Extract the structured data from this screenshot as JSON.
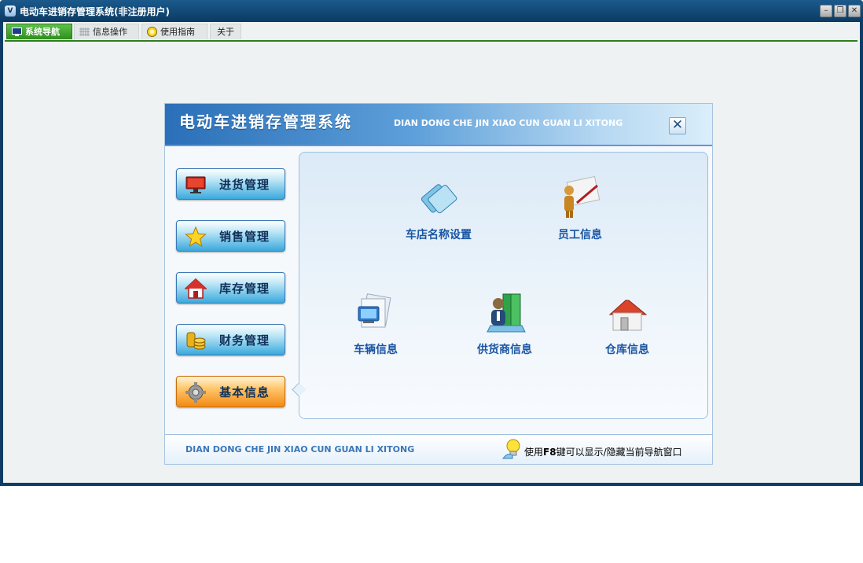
{
  "window": {
    "title": "电动车进销存管理系统(非注册用户)",
    "app_icon_text": "V",
    "controls": {
      "minimize": "–",
      "restore": "❐",
      "close": "✕"
    }
  },
  "tabs": [
    {
      "label": "系统导航",
      "icon": "monitor-icon",
      "active": true
    },
    {
      "label": "信息操作",
      "icon": "grid-icon",
      "active": false
    },
    {
      "label": "使用指南",
      "icon": "help-circle-icon",
      "active": false
    },
    {
      "label": "关于",
      "icon": "",
      "active": false
    }
  ],
  "nav_panel": {
    "title": "电动车进销存管理系统",
    "pinyin": "DIAN DONG CHE JIN XIAO CUN GUAN LI XITONG",
    "close": "✕",
    "side_menu": [
      {
        "label": "进货管理",
        "icon": "monitor-icon",
        "active": false
      },
      {
        "label": "销售管理",
        "icon": "star-icon",
        "active": false
      },
      {
        "label": "库存管理",
        "icon": "home-icon",
        "active": false
      },
      {
        "label": "财务管理",
        "icon": "coins-icon",
        "active": false
      },
      {
        "label": "基本信息",
        "icon": "gear-icon",
        "active": true
      }
    ],
    "items": [
      {
        "label": "车店名称设置",
        "icon": "shop-name-icon"
      },
      {
        "label": "员工信息",
        "icon": "employee-icon"
      },
      {
        "label": "车辆信息",
        "icon": "vehicle-icon"
      },
      {
        "label": "供货商信息",
        "icon": "supplier-icon"
      },
      {
        "label": "仓库信息",
        "icon": "warehouse-icon"
      }
    ],
    "footer": {
      "pinyin": "DIAN DONG CHE JIN XIAO CUN GUAN LI XITONG",
      "hint_prefix": "使用",
      "hint_key": "F8",
      "hint_suffix": "键可以显示/隐藏当前导航窗口",
      "hint_icon": "lightbulb-icon"
    }
  },
  "colors": {
    "title_bar": "#0b3a62",
    "active_tab": "#3ea52a",
    "side_button": "#3aa9dd",
    "side_button_active": "#f28a14",
    "item_label": "#1a55a3"
  }
}
